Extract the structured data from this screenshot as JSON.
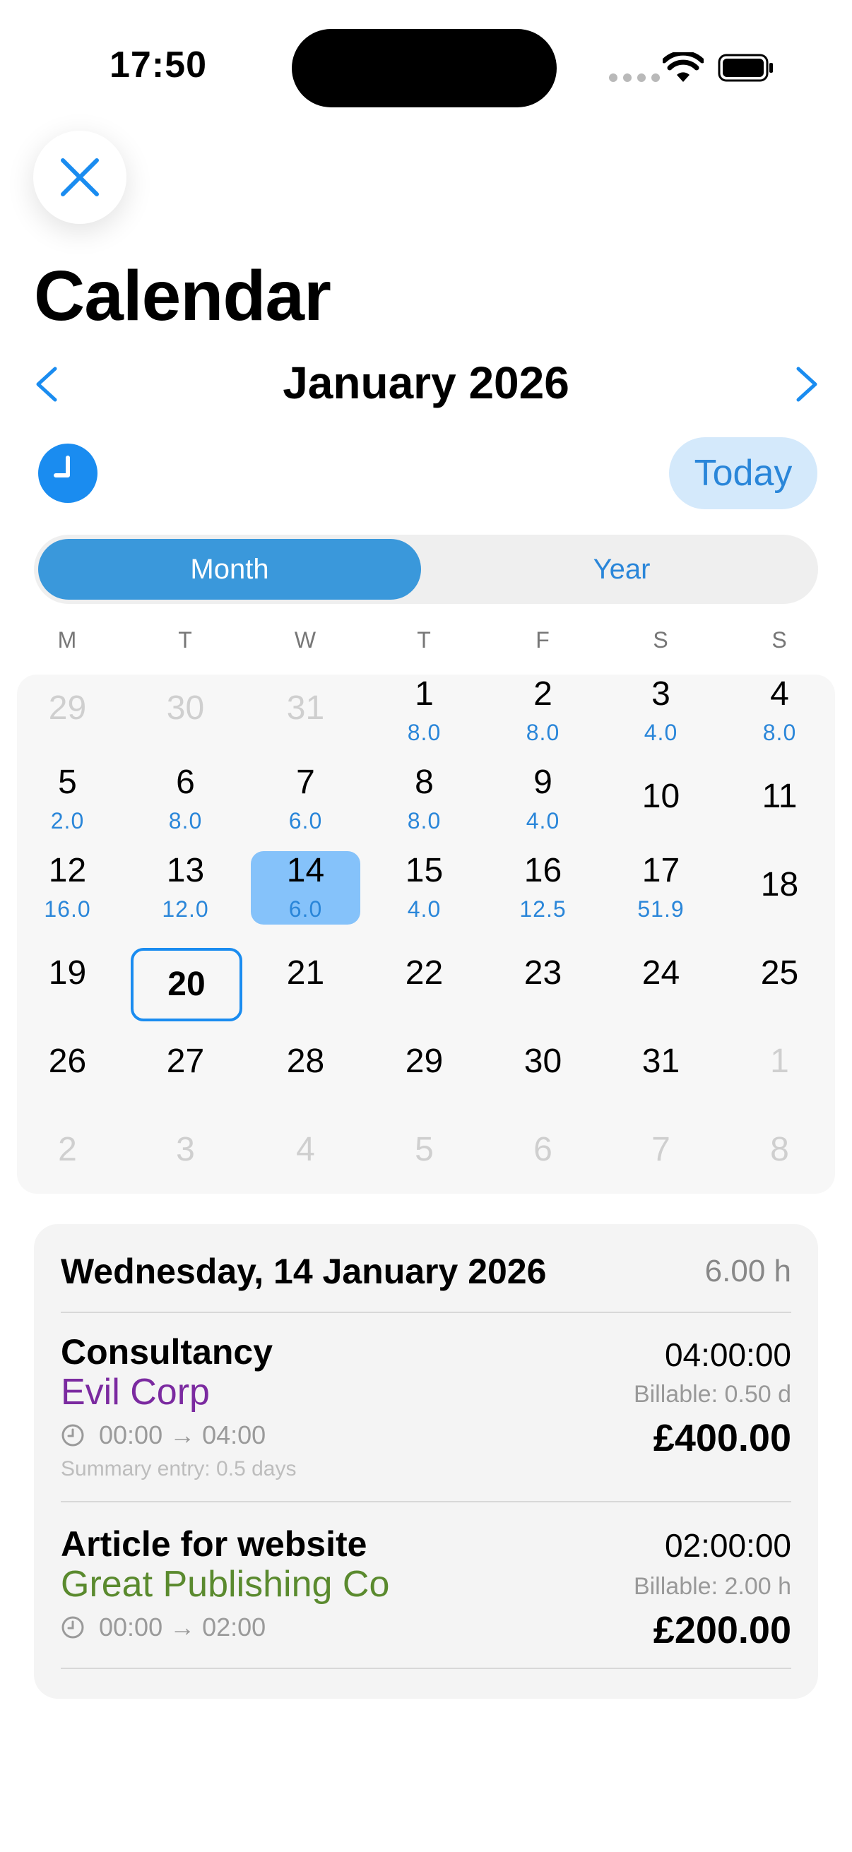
{
  "status_bar": {
    "time": "17:50"
  },
  "header": {
    "title": "Calendar"
  },
  "month_nav": {
    "title": "January 2026"
  },
  "controls": {
    "today_label": "Today"
  },
  "view_toggle": {
    "month_label": "Month",
    "year_label": "Year",
    "selected": "Month"
  },
  "weekdays": [
    "M",
    "T",
    "W",
    "T",
    "F",
    "S",
    "S"
  ],
  "calendar": {
    "weeks": [
      [
        {
          "day": "29",
          "hours": "",
          "other": true
        },
        {
          "day": "30",
          "hours": "",
          "other": true
        },
        {
          "day": "31",
          "hours": "",
          "other": true
        },
        {
          "day": "1",
          "hours": "8.0"
        },
        {
          "day": "2",
          "hours": "8.0"
        },
        {
          "day": "3",
          "hours": "4.0"
        },
        {
          "day": "4",
          "hours": "8.0"
        }
      ],
      [
        {
          "day": "5",
          "hours": "2.0"
        },
        {
          "day": "6",
          "hours": "8.0"
        },
        {
          "day": "7",
          "hours": "6.0"
        },
        {
          "day": "8",
          "hours": "8.0"
        },
        {
          "day": "9",
          "hours": "4.0"
        },
        {
          "day": "10",
          "hours": ""
        },
        {
          "day": "11",
          "hours": ""
        }
      ],
      [
        {
          "day": "12",
          "hours": "16.0"
        },
        {
          "day": "13",
          "hours": "12.0"
        },
        {
          "day": "14",
          "hours": "6.0",
          "selected": true
        },
        {
          "day": "15",
          "hours": "4.0"
        },
        {
          "day": "16",
          "hours": "12.5"
        },
        {
          "day": "17",
          "hours": "51.9"
        },
        {
          "day": "18",
          "hours": ""
        }
      ],
      [
        {
          "day": "19",
          "hours": ""
        },
        {
          "day": "20",
          "hours": "",
          "today": true
        },
        {
          "day": "21",
          "hours": ""
        },
        {
          "day": "22",
          "hours": ""
        },
        {
          "day": "23",
          "hours": ""
        },
        {
          "day": "24",
          "hours": ""
        },
        {
          "day": "25",
          "hours": ""
        }
      ],
      [
        {
          "day": "26",
          "hours": ""
        },
        {
          "day": "27",
          "hours": ""
        },
        {
          "day": "28",
          "hours": ""
        },
        {
          "day": "29",
          "hours": ""
        },
        {
          "day": "30",
          "hours": ""
        },
        {
          "day": "31",
          "hours": ""
        },
        {
          "day": "1",
          "hours": "",
          "other": true
        }
      ],
      [
        {
          "day": "2",
          "hours": "",
          "other": true
        },
        {
          "day": "3",
          "hours": "",
          "other": true
        },
        {
          "day": "4",
          "hours": "",
          "other": true
        },
        {
          "day": "5",
          "hours": "",
          "other": true
        },
        {
          "day": "6",
          "hours": "",
          "other": true
        },
        {
          "day": "7",
          "hours": "",
          "other": true
        },
        {
          "day": "8",
          "hours": "",
          "other": true
        }
      ]
    ]
  },
  "detail": {
    "date": "Wednesday, 14 January 2026",
    "total": "6.00 h",
    "entries": [
      {
        "title": "Consultancy",
        "client": "Evil Corp",
        "client_color": "#7b2aa0",
        "time_range": "00:00 → 04:00",
        "summary": "Summary entry: 0.5 days",
        "duration": "04:00:00",
        "billable": "Billable: 0.50 d",
        "amount": "£400.00"
      },
      {
        "title": "Article for website",
        "client": "Great Publishing Co",
        "client_color": "#5a8a2e",
        "time_range": "00:00 → 02:00",
        "duration": "02:00:00",
        "billable": "Billable: 2.00 h",
        "amount": "£200.00"
      }
    ]
  },
  "colors": {
    "accent": "#1a8cf0",
    "hours": "#2a86d9",
    "selected_day": "#85c2fa"
  }
}
